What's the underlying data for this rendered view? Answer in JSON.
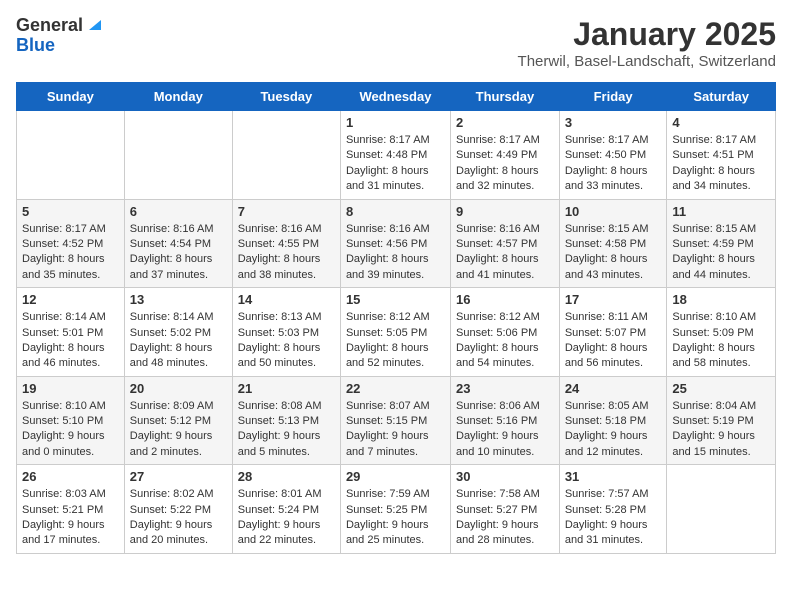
{
  "logo": {
    "general": "General",
    "blue": "Blue"
  },
  "title": "January 2025",
  "subtitle": "Therwil, Basel-Landschaft, Switzerland",
  "weekdays": [
    "Sunday",
    "Monday",
    "Tuesday",
    "Wednesday",
    "Thursday",
    "Friday",
    "Saturday"
  ],
  "weeks": [
    [
      {
        "day": "",
        "info": ""
      },
      {
        "day": "",
        "info": ""
      },
      {
        "day": "",
        "info": ""
      },
      {
        "day": "1",
        "info": "Sunrise: 8:17 AM\nSunset: 4:48 PM\nDaylight: 8 hours and 31 minutes."
      },
      {
        "day": "2",
        "info": "Sunrise: 8:17 AM\nSunset: 4:49 PM\nDaylight: 8 hours and 32 minutes."
      },
      {
        "day": "3",
        "info": "Sunrise: 8:17 AM\nSunset: 4:50 PM\nDaylight: 8 hours and 33 minutes."
      },
      {
        "day": "4",
        "info": "Sunrise: 8:17 AM\nSunset: 4:51 PM\nDaylight: 8 hours and 34 minutes."
      }
    ],
    [
      {
        "day": "5",
        "info": "Sunrise: 8:17 AM\nSunset: 4:52 PM\nDaylight: 8 hours and 35 minutes."
      },
      {
        "day": "6",
        "info": "Sunrise: 8:16 AM\nSunset: 4:54 PM\nDaylight: 8 hours and 37 minutes."
      },
      {
        "day": "7",
        "info": "Sunrise: 8:16 AM\nSunset: 4:55 PM\nDaylight: 8 hours and 38 minutes."
      },
      {
        "day": "8",
        "info": "Sunrise: 8:16 AM\nSunset: 4:56 PM\nDaylight: 8 hours and 39 minutes."
      },
      {
        "day": "9",
        "info": "Sunrise: 8:16 AM\nSunset: 4:57 PM\nDaylight: 8 hours and 41 minutes."
      },
      {
        "day": "10",
        "info": "Sunrise: 8:15 AM\nSunset: 4:58 PM\nDaylight: 8 hours and 43 minutes."
      },
      {
        "day": "11",
        "info": "Sunrise: 8:15 AM\nSunset: 4:59 PM\nDaylight: 8 hours and 44 minutes."
      }
    ],
    [
      {
        "day": "12",
        "info": "Sunrise: 8:14 AM\nSunset: 5:01 PM\nDaylight: 8 hours and 46 minutes."
      },
      {
        "day": "13",
        "info": "Sunrise: 8:14 AM\nSunset: 5:02 PM\nDaylight: 8 hours and 48 minutes."
      },
      {
        "day": "14",
        "info": "Sunrise: 8:13 AM\nSunset: 5:03 PM\nDaylight: 8 hours and 50 minutes."
      },
      {
        "day": "15",
        "info": "Sunrise: 8:12 AM\nSunset: 5:05 PM\nDaylight: 8 hours and 52 minutes."
      },
      {
        "day": "16",
        "info": "Sunrise: 8:12 AM\nSunset: 5:06 PM\nDaylight: 8 hours and 54 minutes."
      },
      {
        "day": "17",
        "info": "Sunrise: 8:11 AM\nSunset: 5:07 PM\nDaylight: 8 hours and 56 minutes."
      },
      {
        "day": "18",
        "info": "Sunrise: 8:10 AM\nSunset: 5:09 PM\nDaylight: 8 hours and 58 minutes."
      }
    ],
    [
      {
        "day": "19",
        "info": "Sunrise: 8:10 AM\nSunset: 5:10 PM\nDaylight: 9 hours and 0 minutes."
      },
      {
        "day": "20",
        "info": "Sunrise: 8:09 AM\nSunset: 5:12 PM\nDaylight: 9 hours and 2 minutes."
      },
      {
        "day": "21",
        "info": "Sunrise: 8:08 AM\nSunset: 5:13 PM\nDaylight: 9 hours and 5 minutes."
      },
      {
        "day": "22",
        "info": "Sunrise: 8:07 AM\nSunset: 5:15 PM\nDaylight: 9 hours and 7 minutes."
      },
      {
        "day": "23",
        "info": "Sunrise: 8:06 AM\nSunset: 5:16 PM\nDaylight: 9 hours and 10 minutes."
      },
      {
        "day": "24",
        "info": "Sunrise: 8:05 AM\nSunset: 5:18 PM\nDaylight: 9 hours and 12 minutes."
      },
      {
        "day": "25",
        "info": "Sunrise: 8:04 AM\nSunset: 5:19 PM\nDaylight: 9 hours and 15 minutes."
      }
    ],
    [
      {
        "day": "26",
        "info": "Sunrise: 8:03 AM\nSunset: 5:21 PM\nDaylight: 9 hours and 17 minutes."
      },
      {
        "day": "27",
        "info": "Sunrise: 8:02 AM\nSunset: 5:22 PM\nDaylight: 9 hours and 20 minutes."
      },
      {
        "day": "28",
        "info": "Sunrise: 8:01 AM\nSunset: 5:24 PM\nDaylight: 9 hours and 22 minutes."
      },
      {
        "day": "29",
        "info": "Sunrise: 7:59 AM\nSunset: 5:25 PM\nDaylight: 9 hours and 25 minutes."
      },
      {
        "day": "30",
        "info": "Sunrise: 7:58 AM\nSunset: 5:27 PM\nDaylight: 9 hours and 28 minutes."
      },
      {
        "day": "31",
        "info": "Sunrise: 7:57 AM\nSunset: 5:28 PM\nDaylight: 9 hours and 31 minutes."
      },
      {
        "day": "",
        "info": ""
      }
    ]
  ]
}
